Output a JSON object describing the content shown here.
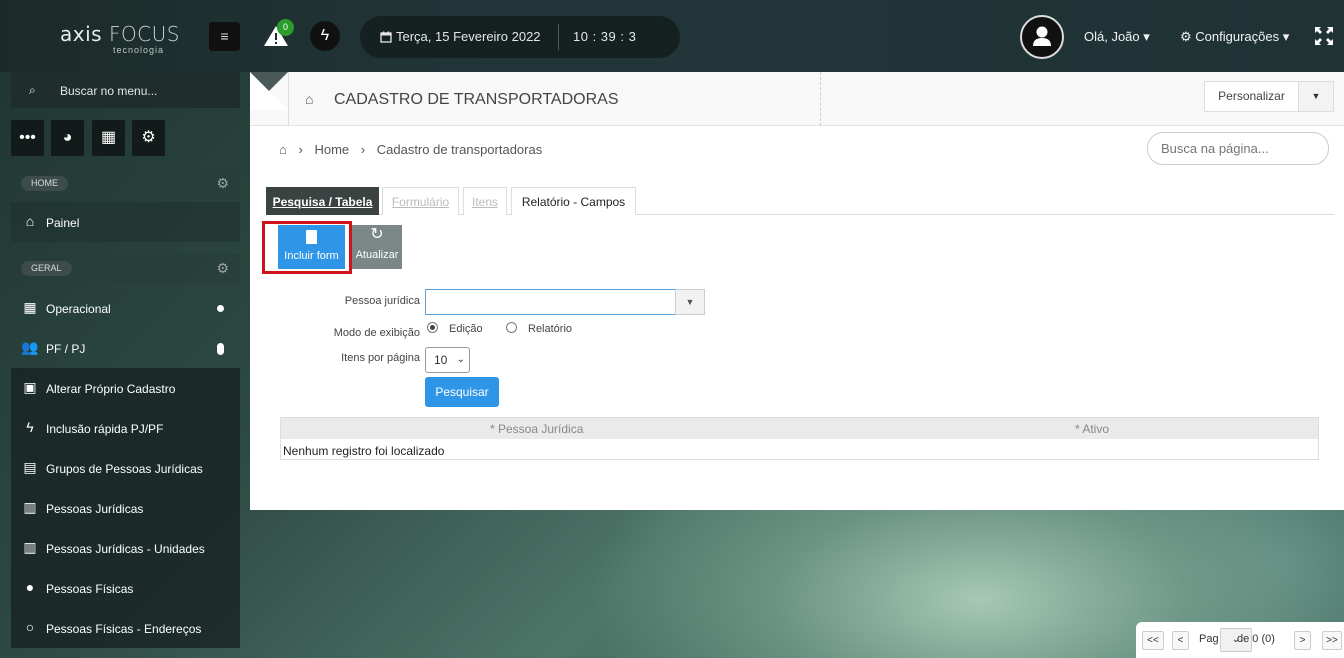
{
  "header": {
    "brand_main": "axis",
    "brand_focus": "FOCUS",
    "brand_sub": "tecnologia",
    "menu_glyph": "≡",
    "alert_count": "0",
    "bolt_glyph": "ϟ",
    "date": "Terça, 15 Fevereiro 2022",
    "time": "10 : 39 : 3",
    "user_label": "Olá, João ▾",
    "config_label": "⚙ Configurações ▾"
  },
  "sidebar": {
    "search_icon": "⌕",
    "search_label": "Buscar no menu...",
    "quick_buttons": [
      "•••",
      "◕",
      "▦",
      "⚙"
    ],
    "sections": [
      {
        "label": "HOME"
      },
      {
        "label": "GERAL"
      }
    ],
    "items": [
      {
        "icon": "⌂",
        "label": "Painel"
      },
      {
        "icon": "▦",
        "label": "Operacional"
      },
      {
        "icon": "👥",
        "label": "PF / PJ"
      },
      {
        "icon": "▣",
        "label": "Alterar Próprio Cadastro"
      },
      {
        "icon": "ϟ",
        "label": "Inclusão rápida PJ/PF"
      },
      {
        "icon": "▤",
        "label": "Grupos de Pessoas Jurídicas"
      },
      {
        "icon": "▥",
        "label": "Pessoas Jurídicas"
      },
      {
        "icon": "▥",
        "label": "Pessoas Jurídicas - Unidades"
      },
      {
        "icon": "●",
        "label": "Pessoas Físicas"
      },
      {
        "icon": "○",
        "label": "Pessoas Físicas - Endereços"
      }
    ]
  },
  "main": {
    "title": "CADASTRO DE TRANSPORTADORAS",
    "personalizar": "Personalizar",
    "breadcrumb": [
      "Home",
      "Cadastro de transportadoras"
    ],
    "search_placeholder": "Busca na página...",
    "tabs": [
      {
        "label": "Pesquisa / Tabela",
        "state": "active"
      },
      {
        "label": "Formulário",
        "state": "disabled"
      },
      {
        "label": "Itens",
        "state": "disabled"
      },
      {
        "label": "Relatório - Campos",
        "state": "normal"
      }
    ],
    "btn_incluir": "Incluir form",
    "btn_atualizar": "Atualizar",
    "refresh_glyph": "↻",
    "form": {
      "pj_label": "Pessoa jurídica",
      "modo_label": "Modo de exibição",
      "modo_options": [
        "Edição",
        "Relatório"
      ],
      "modo_selected": "Edição",
      "itens_label": "Itens por página",
      "itens_value": "10",
      "pesquisar": "Pesquisar"
    },
    "grid": {
      "columns": [
        "* Pessoa Jurídica",
        "* Ativo"
      ],
      "empty_text": "Nenhum registro foi localizado"
    }
  },
  "pager": {
    "first": "<<",
    "prev": "<",
    "page_label": "Pag",
    "of_label": "de 0 (0)",
    "next": ">",
    "last": ">>"
  },
  "colors": {
    "primary": "#2f95e6",
    "highlight_frame": "#d0121b",
    "badge_green": "#2a9d2a"
  }
}
